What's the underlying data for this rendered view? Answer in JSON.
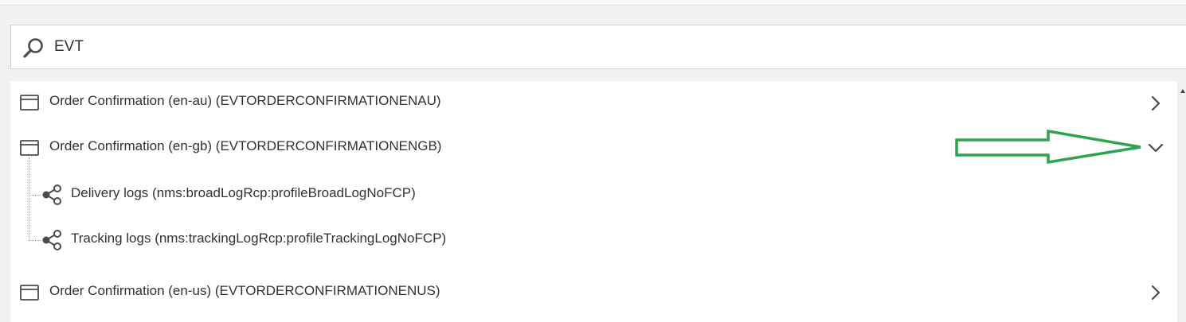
{
  "search": {
    "value": "EVT",
    "icon": "search-icon"
  },
  "results": [
    {
      "label": "Order Confirmation (en-au) (EVTORDERCONFIRMATIONENAU)",
      "icon": "document-icon",
      "state": "collapsed"
    },
    {
      "label": "Order Confirmation (en-gb) (EVTORDERCONFIRMATIONENGB)",
      "icon": "document-icon",
      "state": "expanded",
      "children": [
        {
          "label": "Delivery logs (nms:broadLogRcp:profileBroadLogNoFCP)",
          "icon": "link-icon"
        },
        {
          "label": "Tracking logs (nms:trackingLogRcp:profileTrackingLogNoFCP)",
          "icon": "link-icon"
        }
      ]
    },
    {
      "label": "Order Confirmation (en-us) (EVTORDERCONFIRMATIONENUS)",
      "icon": "document-icon",
      "state": "collapsed"
    }
  ],
  "colors": {
    "annotation_arrow": "#2ea44f",
    "background": "#f1f1f1",
    "panel": "#ffffff",
    "text": "#323232"
  }
}
